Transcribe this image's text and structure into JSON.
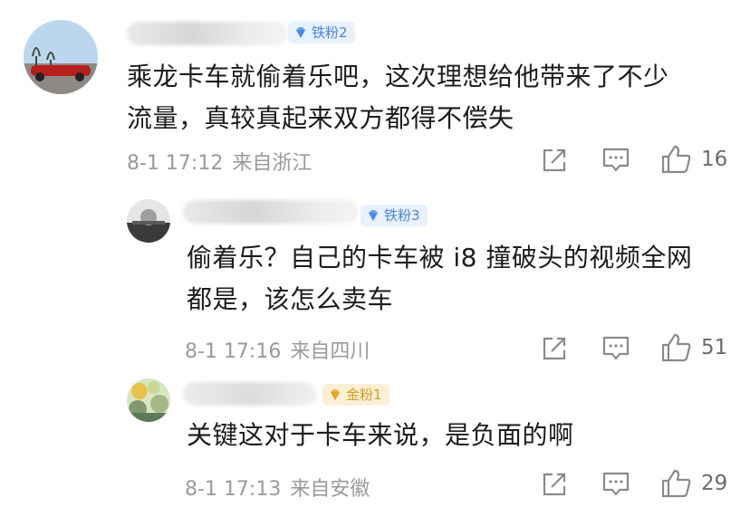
{
  "comments": [
    {
      "badge": "铁粉2",
      "badge_style": "blue",
      "text_lines": [
        "乘龙卡车就偷着乐吧，这次理想给他带来了不少",
        "流量，真较真起来双方都得不偿失"
      ],
      "date": "8-1 17:12",
      "location": "来自浙江",
      "likes": "16"
    },
    {
      "badge": "铁粉3",
      "badge_style": "blue",
      "text_lines": [
        "偷着乐？自己的卡车被 i8 撞破头的视频全网",
        "都是，该怎么卖车"
      ],
      "date": "8-1 17:16",
      "location": "来自四川",
      "likes": "51"
    },
    {
      "name_visible": "合肥旅游通",
      "badge": "金粉1",
      "badge_style": "gold",
      "text_lines": [
        "关键这对于卡车来说，是负面的啊"
      ],
      "date": "8-1 17:13",
      "location": "来自安徽",
      "likes": "29"
    }
  ],
  "icons": {
    "share": "share-icon",
    "reply": "comment-icon",
    "like": "thumbs-up-icon",
    "badge": "diamond-icon"
  },
  "colors": {
    "badge_blue_bg": "#e8f1fd",
    "badge_blue_text": "#4a86d9",
    "badge_gold_bg": "#fbf0d6",
    "badge_gold_text": "#d59a1c",
    "meta_gray": "#9a9a9a"
  }
}
